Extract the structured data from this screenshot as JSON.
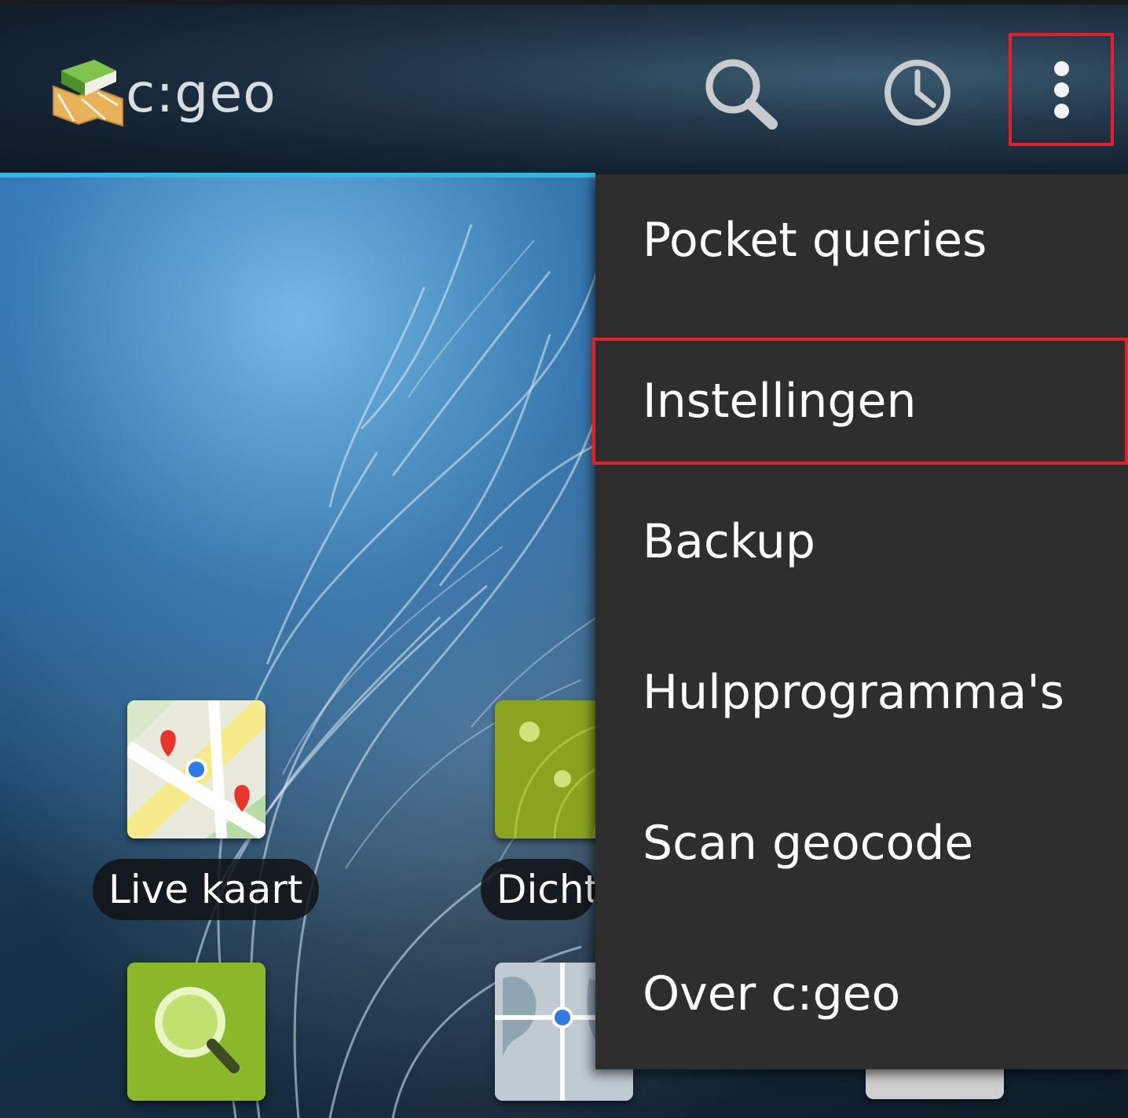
{
  "app": {
    "title": "c:geo"
  },
  "action_bar": {
    "icons": [
      "search-icon",
      "history-icon",
      "overflow-menu-icon"
    ],
    "accent_color": "#33b5e5",
    "highlight_color": "#e5202b"
  },
  "launcher": {
    "tiles": [
      {
        "label": "Live kaart",
        "icon": "map-icon"
      },
      {
        "label": "Dichtbij",
        "icon": "radar-icon"
      },
      {
        "label": "",
        "icon": "search-icon"
      },
      {
        "label": "",
        "icon": "globe-map-icon"
      }
    ]
  },
  "menu": {
    "items": [
      {
        "label": "Pocket queries"
      },
      {
        "label": "Instellingen",
        "highlighted": true
      },
      {
        "label": "Backup"
      },
      {
        "label": "Hulpprogramma's"
      },
      {
        "label": "Scan geocode"
      },
      {
        "label": "Over c:geo"
      }
    ]
  }
}
